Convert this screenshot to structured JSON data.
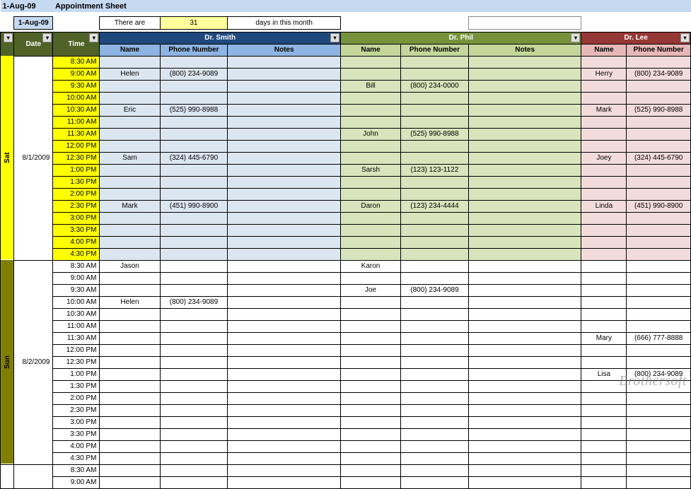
{
  "title": {
    "date_label": "1-Aug-09",
    "sheet_name": "Appointment Sheet"
  },
  "info": {
    "date": "1-Aug-09",
    "there_are": "There are",
    "days_count": "31",
    "days_text": "days in this month"
  },
  "headers": {
    "date": "Date",
    "time": "Time",
    "doctors": [
      {
        "name": "Dr. Smith",
        "cols": {
          "name": "Name",
          "phone": "Phone Number",
          "notes": "Notes"
        }
      },
      {
        "name": "Dr. Phil",
        "cols": {
          "name": "Name",
          "phone": "Phone Number",
          "notes": "Notes"
        }
      },
      {
        "name": "Dr. Lee",
        "cols": {
          "name": "Name",
          "phone": "Phone Number"
        }
      }
    ]
  },
  "days": [
    {
      "label": "Sat",
      "date": "8/1/2009",
      "fill_smith": true,
      "fill_phil": true,
      "fill_lee": true,
      "slots": [
        {
          "time": "8:30 AM",
          "smith": {},
          "phil": {},
          "lee": {}
        },
        {
          "time": "9:00 AM",
          "smith": {
            "name": "Helen",
            "phone": "(800) 234-9089"
          },
          "phil": {},
          "lee": {
            "name": "Herry",
            "phone": "(800) 234-9089"
          }
        },
        {
          "time": "9:30 AM",
          "smith": {},
          "phil": {
            "name": "Bill",
            "phone": "(800) 234-0000"
          },
          "lee": {}
        },
        {
          "time": "10:00 AM",
          "smith": {},
          "phil": {},
          "lee": {}
        },
        {
          "time": "10:30 AM",
          "smith": {
            "name": "Eric",
            "phone": "(525) 990-8988"
          },
          "phil": {},
          "lee": {
            "name": "Mark",
            "phone": "(525) 990-8988"
          }
        },
        {
          "time": "11:00 AM",
          "smith": {},
          "phil": {},
          "lee": {}
        },
        {
          "time": "11:30 AM",
          "smith": {},
          "phil": {
            "name": "John",
            "phone": "(525) 990-8988"
          },
          "lee": {}
        },
        {
          "time": "12:00 PM",
          "smith": {},
          "phil": {},
          "lee": {}
        },
        {
          "time": "12:30 PM",
          "smith": {
            "name": "Sam",
            "phone": "(324) 445-6790"
          },
          "phil": {},
          "lee": {
            "name": "Joey",
            "phone": "(324) 445-6790"
          }
        },
        {
          "time": "1:00 PM",
          "smith": {},
          "phil": {
            "name": "Sarsh",
            "phone": "(123) 123-1122"
          },
          "lee": {}
        },
        {
          "time": "1:30 PM",
          "smith": {},
          "phil": {},
          "lee": {}
        },
        {
          "time": "2:00 PM",
          "smith": {},
          "phil": {},
          "lee": {}
        },
        {
          "time": "2:30 PM",
          "smith": {
            "name": "Mark",
            "phone": "(451) 990-8900"
          },
          "phil": {
            "name": "Daron",
            "phone": "(123) 234-4444"
          },
          "lee": {
            "name": "Linda",
            "phone": "(451) 990-8900"
          }
        },
        {
          "time": "3:00 PM",
          "smith": {},
          "phil": {},
          "lee": {}
        },
        {
          "time": "3:30 PM",
          "smith": {},
          "phil": {},
          "lee": {}
        },
        {
          "time": "4:00 PM",
          "smith": {},
          "phil": {},
          "lee": {}
        },
        {
          "time": "4:30 PM",
          "smith": {},
          "phil": {},
          "lee": {}
        }
      ]
    },
    {
      "label": "Sun",
      "date": "8/2/2009",
      "fill_smith": false,
      "fill_phil": false,
      "fill_lee": false,
      "slots": [
        {
          "time": "8:30 AM",
          "smith": {
            "name": "Jason",
            "phone": ""
          },
          "phil": {
            "name": "Karon",
            "phone": ""
          },
          "lee": {}
        },
        {
          "time": "9:00 AM",
          "smith": {},
          "phil": {},
          "lee": {}
        },
        {
          "time": "9:30 AM",
          "smith": {},
          "phil": {
            "name": "Joe",
            "phone": "(800) 234-9089"
          },
          "lee": {}
        },
        {
          "time": "10:00 AM",
          "smith": {
            "name": "Helen",
            "phone": "(800) 234-9089"
          },
          "phil": {},
          "lee": {}
        },
        {
          "time": "10:30 AM",
          "smith": {},
          "phil": {},
          "lee": {}
        },
        {
          "time": "11:00 AM",
          "smith": {},
          "phil": {},
          "lee": {}
        },
        {
          "time": "11:30 AM",
          "smith": {},
          "phil": {},
          "lee": {
            "name": "Mary",
            "phone": "(666) 777-8888"
          }
        },
        {
          "time": "12:00 PM",
          "smith": {},
          "phil": {},
          "lee": {}
        },
        {
          "time": "12:30 PM",
          "smith": {},
          "phil": {},
          "lee": {}
        },
        {
          "time": "1:00 PM",
          "smith": {},
          "phil": {},
          "lee": {
            "name": "Lisa",
            "phone": "(800) 234-9089"
          }
        },
        {
          "time": "1:30 PM",
          "smith": {},
          "phil": {},
          "lee": {}
        },
        {
          "time": "2:00 PM",
          "smith": {},
          "phil": {},
          "lee": {}
        },
        {
          "time": "2:30 PM",
          "smith": {},
          "phil": {},
          "lee": {}
        },
        {
          "time": "3:00 PM",
          "smith": {},
          "phil": {},
          "lee": {}
        },
        {
          "time": "3:30 PM",
          "smith": {},
          "phil": {},
          "lee": {}
        },
        {
          "time": "4:00 PM",
          "smith": {},
          "phil": {},
          "lee": {}
        },
        {
          "time": "4:30 PM",
          "smith": {},
          "phil": {},
          "lee": {}
        }
      ]
    },
    {
      "label": "",
      "date": "",
      "fill_smith": false,
      "fill_phil": false,
      "fill_lee": false,
      "slots": [
        {
          "time": "8:30 AM",
          "smith": {},
          "phil": {},
          "lee": {}
        },
        {
          "time": "9:00 AM",
          "smith": {},
          "phil": {},
          "lee": {}
        }
      ]
    }
  ],
  "watermark": "Brothersoft",
  "extra_name": "(666) 777-8888"
}
